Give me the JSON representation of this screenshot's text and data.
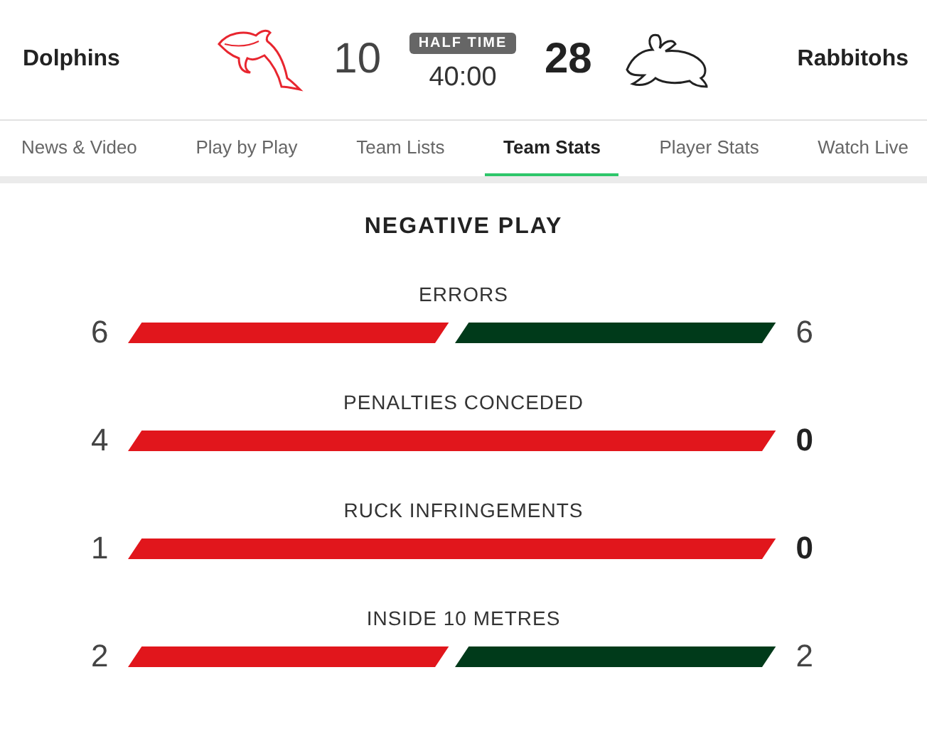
{
  "match": {
    "home": {
      "name": "Dolphins",
      "score": "10",
      "leading": false
    },
    "away": {
      "name": "Rabbitohs",
      "score": "28",
      "leading": true
    },
    "status": "HALF TIME",
    "clock": "40:00"
  },
  "tabs": [
    {
      "label": "News & Video",
      "selected": false
    },
    {
      "label": "Play by Play",
      "selected": false
    },
    {
      "label": "Team Lists",
      "selected": false
    },
    {
      "label": "Team Stats",
      "selected": true
    },
    {
      "label": "Player Stats",
      "selected": false
    },
    {
      "label": "Watch Live",
      "selected": false
    }
  ],
  "section": {
    "title": "NEGATIVE PLAY",
    "stats": [
      {
        "label": "ERRORS",
        "home": "6",
        "away": "6",
        "home_bold": false,
        "away_bold": false
      },
      {
        "label": "PENALTIES CONCEDED",
        "home": "4",
        "away": "0",
        "home_bold": false,
        "away_bold": true
      },
      {
        "label": "RUCK INFRINGEMENTS",
        "home": "1",
        "away": "0",
        "home_bold": false,
        "away_bold": true
      },
      {
        "label": "INSIDE 10 METRES",
        "home": "2",
        "away": "2",
        "home_bold": false,
        "away_bold": false
      }
    ]
  }
}
